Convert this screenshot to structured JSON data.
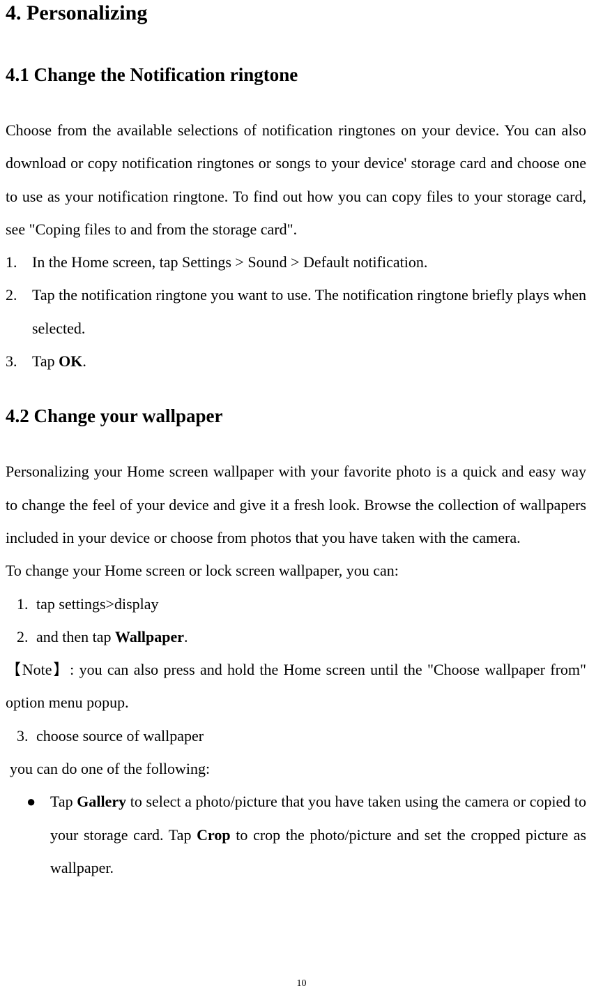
{
  "title": "4. Personalizing",
  "section1": {
    "heading": "4.1 Change the Notification ringtone",
    "para": "Choose from the available selections of notification ringtones on your device. You can also download or copy notification ringtones or songs to your device' storage card and choose one to use as your notification ringtone. To find out how you can copy files to your storage card, see \"Coping files to and from the storage card\".",
    "steps": [
      {
        "num": "1.",
        "text": "In the Home screen, tap Settings > Sound > Default notification."
      },
      {
        "num": "2.",
        "text": "Tap the notification ringtone you want to use. The notification ringtone briefly plays when selected."
      },
      {
        "num": "3.",
        "prefix": "Tap ",
        "bold": "OK",
        "suffix": "."
      }
    ]
  },
  "section2": {
    "heading": "4.2 Change your wallpaper",
    "para": "Personalizing your Home screen wallpaper with your favorite photo is a quick and easy way to change the feel of your device and give it a fresh look. Browse the collection of wallpapers included in your device or choose from photos that you have taken with the camera.",
    "intro": "To change your Home screen or lock screen wallpaper, you can:",
    "steps1": [
      {
        "num": "1.",
        "text": "tap settings>display"
      },
      {
        "num": "2.",
        "prefix": "and then tap ",
        "bold": "Wallpaper",
        "suffix": "."
      }
    ],
    "note": {
      "label": "【Note】",
      "text": ": you can also press and hold the Home screen until the \"Choose wallpaper from\" option menu popup."
    },
    "steps2": [
      {
        "num": "3.",
        "text": "choose source of wallpaper"
      }
    ],
    "sub_intro": "you can do one of the following:",
    "bullets": [
      {
        "mark": "●",
        "prefix": "Tap ",
        "bold1": "Gallery",
        "mid": " to select a photo/picture that you have taken using the camera or copied to your storage card. Tap ",
        "bold2": "Crop",
        "suffix": " to crop the photo/picture and set the cropped picture as wallpaper."
      }
    ]
  },
  "page_number": "10"
}
